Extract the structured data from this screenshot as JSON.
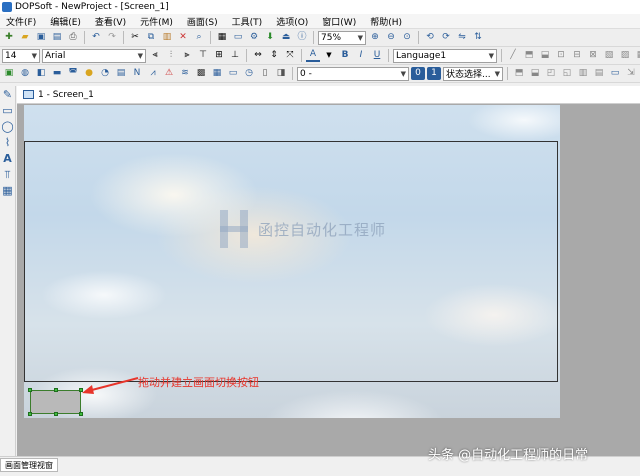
{
  "window": {
    "title": "DOPSoft - NewProject - [Screen_1]"
  },
  "menu": [
    "文件(F)",
    "编辑(E)",
    "查看(V)",
    "元件(M)",
    "画面(S)",
    "工具(T)",
    "选项(O)",
    "窗口(W)",
    "帮助(H)"
  ],
  "toolbar1": {
    "zoom_value": "75%"
  },
  "toolbar2": {
    "font_size": "14",
    "font_name": "Arial",
    "bold": "B",
    "italic": "I",
    "underline": "U",
    "language": "Language1"
  },
  "toolbar3": {
    "value_select": "0 -",
    "zero_btn": "0",
    "one_btn": "1",
    "state_select": "状态选择..."
  },
  "document_tab": {
    "label": "1 - Screen_1"
  },
  "watermark": {
    "text": "函控自动化工程师"
  },
  "annotation": {
    "text": "拖动并建立画面切换按钮"
  },
  "bottom_panel": {
    "tab_label": "画面管理视窗"
  },
  "credit": {
    "text": "头条 @自动化工程师的日常"
  },
  "colors": {
    "annotation": "#e8352b",
    "selection": "#3fbf3f",
    "workspace": "#a9a9a9"
  }
}
